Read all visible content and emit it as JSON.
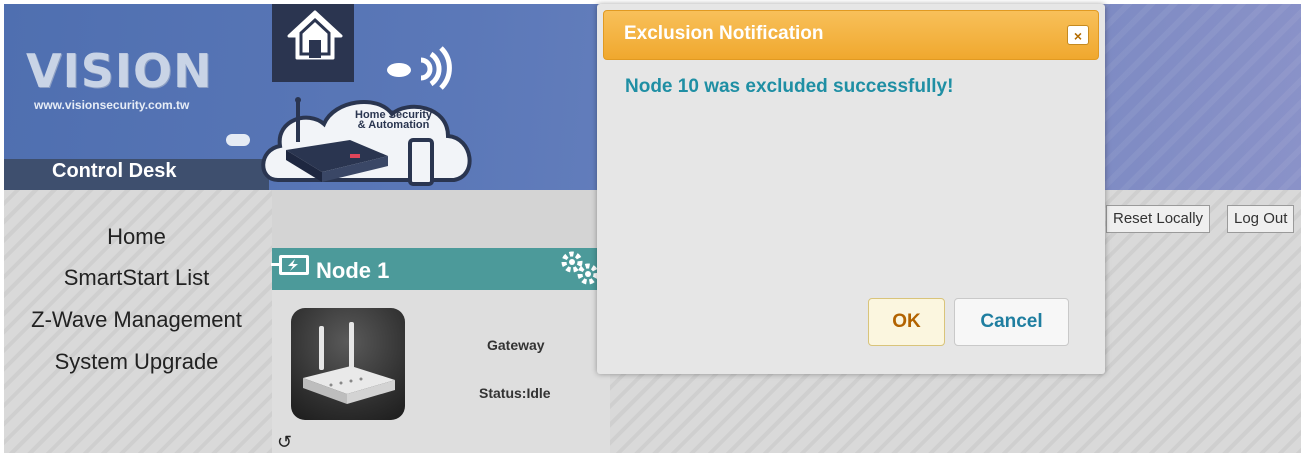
{
  "header": {
    "logo": "VISION",
    "url": "www.visionsecurity.com.tw",
    "control_desk": "Control Desk",
    "cloud_text_line1": "Home Security",
    "cloud_text_line2": "& Automation"
  },
  "sidebar": {
    "items": [
      {
        "label": "Home"
      },
      {
        "label": "SmartStart List"
      },
      {
        "label": "Z-Wave Management"
      },
      {
        "label": "System Upgrade"
      }
    ]
  },
  "toolbar": {
    "reset_label": "Reset Locally",
    "logout_label": "Log Out"
  },
  "node": {
    "title": "Node 1",
    "type": "Gateway",
    "status": "Status:Idle"
  },
  "dialog": {
    "title": "Exclusion Notification",
    "close": "×",
    "message": "Node 10 was excluded successfully!",
    "ok_label": "OK",
    "cancel_label": "Cancel"
  },
  "colors": {
    "dialog_header": "#f0a82e",
    "message": "#1f8fa4",
    "node_header": "#4c9a9a"
  }
}
